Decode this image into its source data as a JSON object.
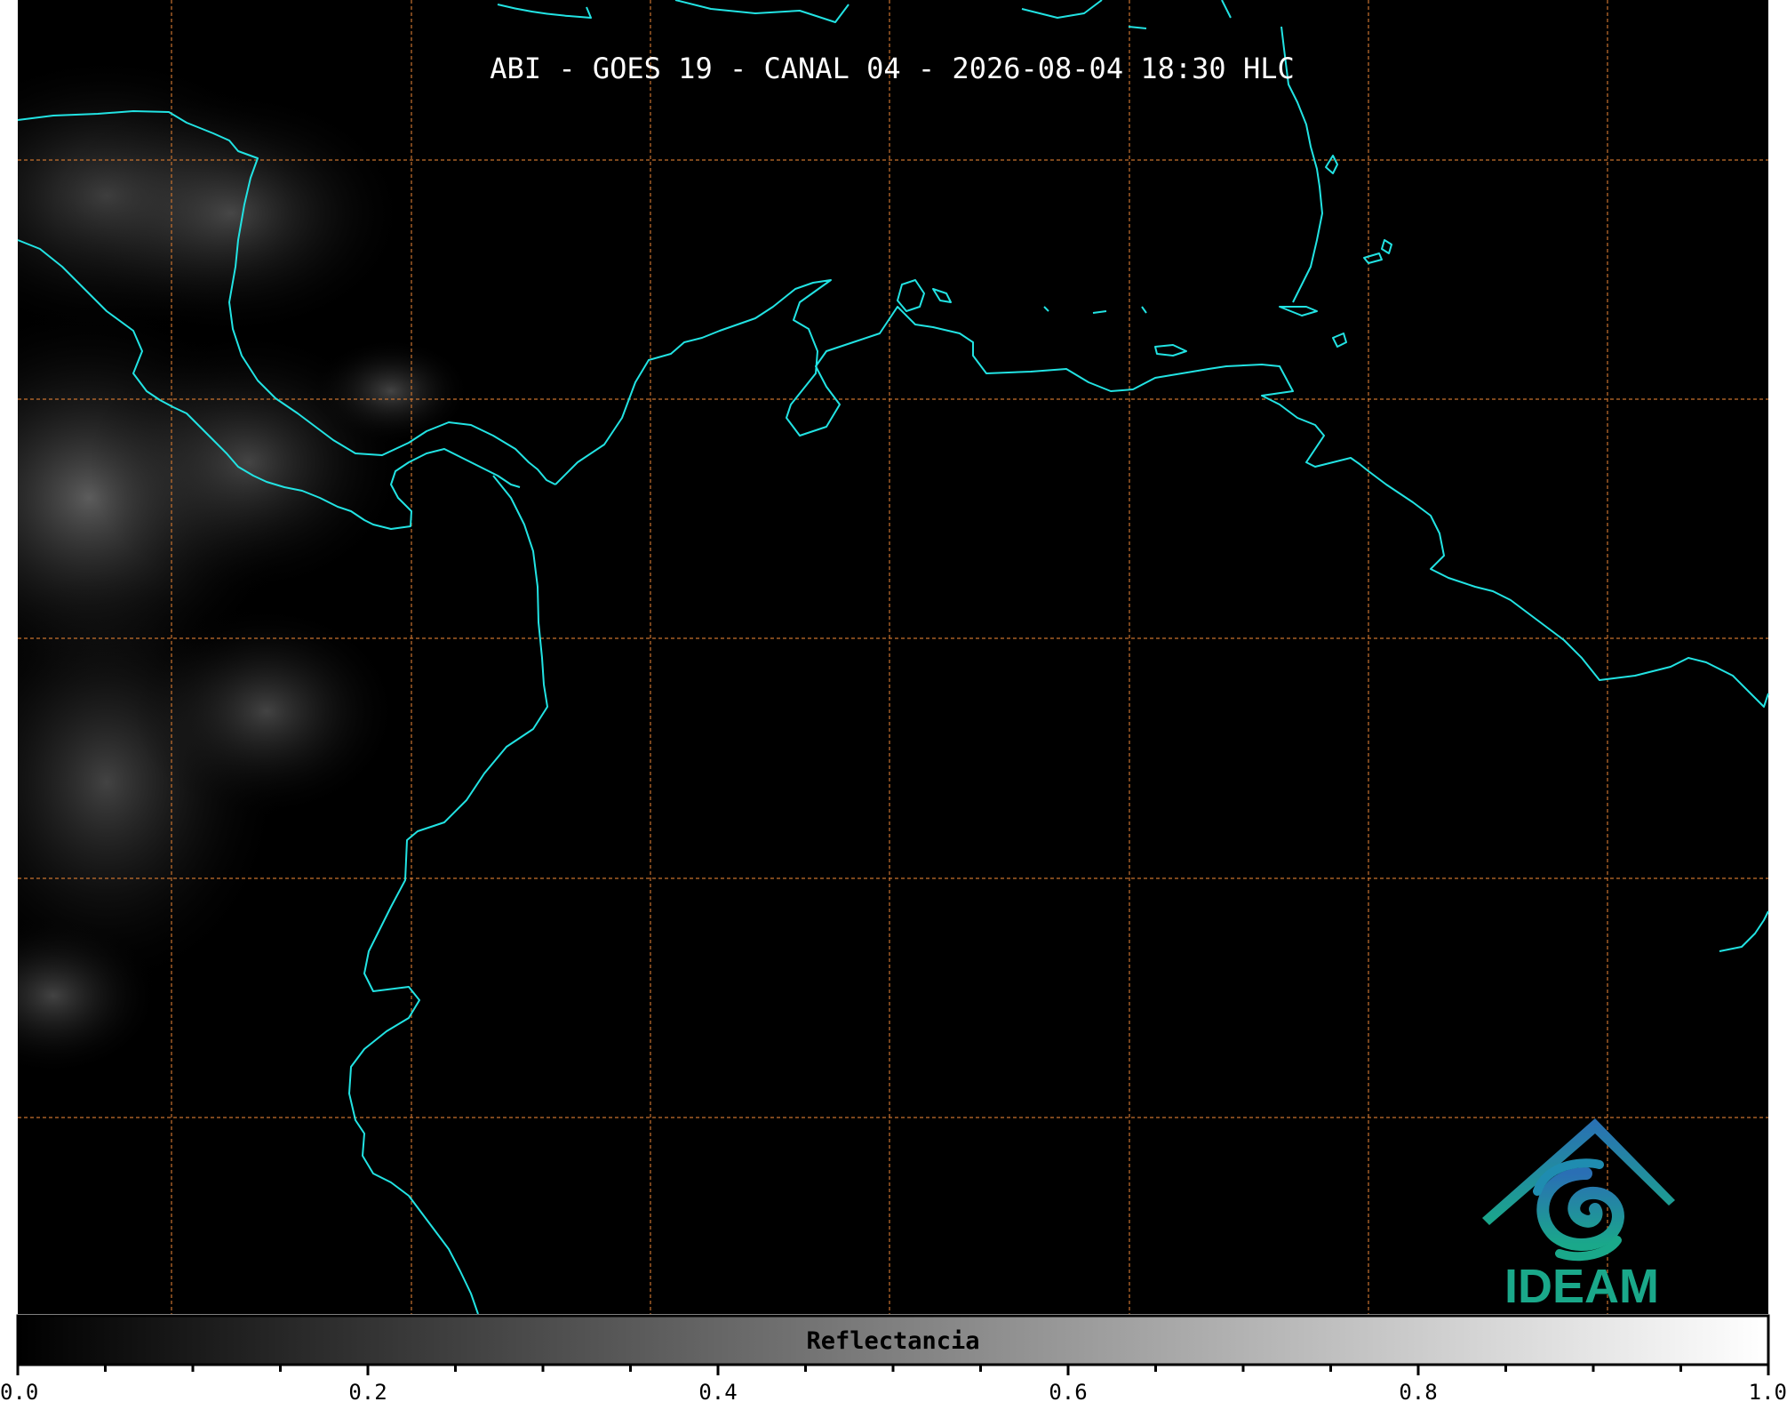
{
  "title": "ABI - GOES 19 - CANAL 04 - 2026-08-04 18:30 HLC",
  "logo": {
    "text": "IDEAM"
  },
  "colorbar": {
    "label": "Reflectancia",
    "ticks": [
      "0.0",
      "0.2",
      "0.4",
      "0.6",
      "0.8",
      "1.0"
    ]
  },
  "colors": {
    "background": "#000000",
    "coastline": "#22e3e3",
    "gridlines": "#c8722e",
    "logo_blue": "#2a6fb5",
    "logo_green": "#1aa88a"
  }
}
